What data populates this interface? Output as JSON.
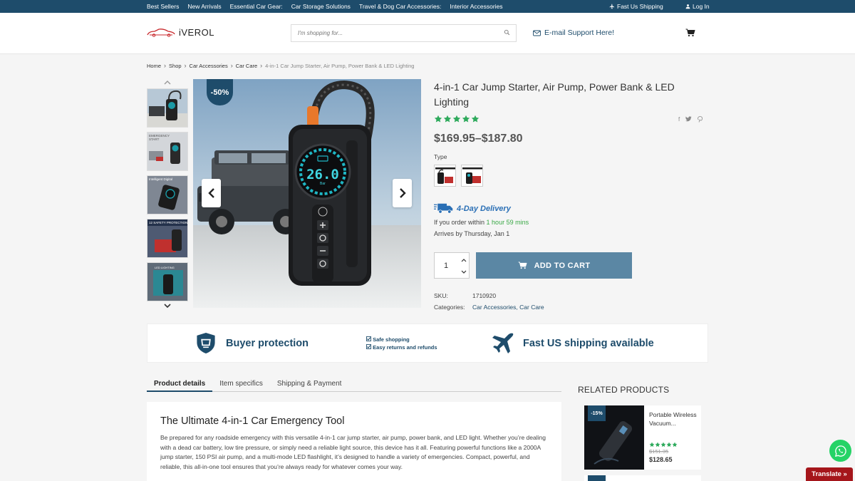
{
  "topbar": {
    "nav": [
      "Best Sellers",
      "New Arrivals",
      "Essential Car Gear:",
      "Car Storage Solutions",
      "Travel & Dog Car Accessories:",
      "Interior Accessories"
    ],
    "shipping": "Fast Us Shipping",
    "login": "Log In"
  },
  "header": {
    "logo": "iVEROL",
    "search_placeholder": "I'm shopping for...",
    "support": "E-mail Support Here!"
  },
  "breadcrumb": [
    "Home",
    "Shop",
    "Car Accessories",
    "Car Care",
    "4-in-1 Car Jump Starter, Air Pump, Power Bank & LED Lighting"
  ],
  "gallery": {
    "discount": "-50%",
    "display_text": "26.0"
  },
  "product": {
    "title": "4-in-1 Car Jump Starter, Air Pump, Power Bank & LED Lighting",
    "rating": 5,
    "price": "$169.95–$187.80",
    "type_label": "Type",
    "delivery": "4-Day Delivery",
    "order_prefix": "If you order within ",
    "order_time": "1 hour 59 mins",
    "arrives": "Arrives by Thursday, Jan 1",
    "quantity": "1",
    "add_to_cart": "ADD TO CART",
    "sku_label": "SKU:",
    "sku": "1710920",
    "categories_label": "Categories:",
    "categories": "Car Accessories, Car Care"
  },
  "trust": {
    "buyer_protection": "Buyer protection",
    "checks": [
      "Safe shopping",
      "Easy returns and refunds"
    ],
    "fast_shipping": "Fast US shipping available"
  },
  "tabs": [
    "Product details",
    "Item specifics",
    "Shipping & Payment"
  ],
  "details": {
    "heading": "The Ultimate 4-in-1 Car Emergency Tool",
    "body": "Be prepared for any roadside emergency with this versatile 4-in-1 car jump starter, air pump, power bank, and LED light. Whether you’re dealing with a dead car battery, low tire pressure, or simply need a reliable light source, this device has it all. Featuring powerful functions like a 2000A jump starter, 150 PSI air pump, and a multi-mode LED flashlight, it’s designed to handle a variety of emergencies. Compact, powerful, and reliable, this all-in-one tool ensures that you’re always ready for whatever comes your way."
  },
  "related": {
    "title": "RELATED PRODUCTS",
    "items": [
      {
        "badge": "-15%",
        "name": "Portable Wireless Vacuum...",
        "rating": 5,
        "old_price": "$151.35",
        "price": "$128.65"
      }
    ]
  },
  "widgets": {
    "translate": "Translate »"
  },
  "colors": {
    "navy": "#1e4c6b",
    "button": "#5b87a4",
    "star": "#2eaa5c",
    "delivery": "#2a6fb5",
    "timer": "#39a845",
    "translate": "#a5161b"
  }
}
